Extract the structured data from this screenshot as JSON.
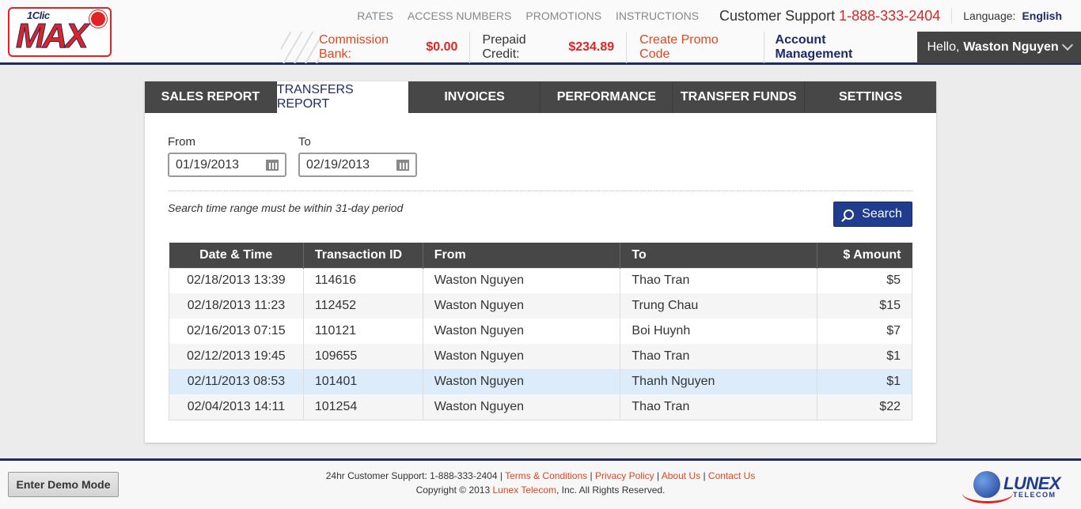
{
  "logo": {
    "top": "1Clic",
    "main": "MAX"
  },
  "topnav": {
    "links": [
      "RATES",
      "ACCESS NUMBERS",
      "PROMOTIONS",
      "INSTRUCTIONS"
    ],
    "support_label": "Customer Support",
    "support_phone": "1-888-333-2404",
    "language_label": "Language:",
    "language_value": "English"
  },
  "subbar": {
    "commission_label": "Commission Bank:",
    "commission_value": "$0.00",
    "prepaid_label": "Prepaid Credit:",
    "prepaid_value": "$234.89",
    "promo": "Create Promo Code",
    "account": "Account Management",
    "hello": "Hello,",
    "user": "Waston Nguyen"
  },
  "tabs": [
    "SALES REPORT",
    "TRANSFERS REPORT",
    "INVOICES",
    "PERFORMANCE",
    "TRANSFER FUNDS",
    "SETTINGS"
  ],
  "active_tab": "TRANSFERS REPORT",
  "filters": {
    "from_label": "From",
    "from_value": "01/19/2013",
    "to_label": "To",
    "to_value": "02/19/2013",
    "hint": "Search time range must be within 31-day period",
    "search": "Search"
  },
  "table": {
    "headers": [
      "Date & Time",
      "Transaction ID",
      "From",
      "To",
      "$ Amount"
    ],
    "rows": [
      [
        "02/18/2013 13:39",
        "114616",
        "Waston Nguyen",
        "Thao Tran",
        "$5"
      ],
      [
        "02/18/2013 11:23",
        "112452",
        "Waston Nguyen",
        "Trung Chau",
        "$15"
      ],
      [
        "02/16/2013 07:15",
        "110121",
        "Waston Nguyen",
        "Boi Huynh",
        "$7"
      ],
      [
        "02/12/2013 19:45",
        "109655",
        "Waston Nguyen",
        "Thao Tran",
        "$1"
      ],
      [
        "02/11/2013 08:53",
        "101401",
        "Waston Nguyen",
        "Thanh Nguyen",
        "$1"
      ],
      [
        "02/04/2013 14:11",
        "101254",
        "Waston Nguyen",
        "Thao Tran",
        "$22"
      ]
    ]
  },
  "footer": {
    "demo": "Enter Demo Mode",
    "support": "24hr Customer Support: 1-888-333-2404",
    "terms": "Terms & Conditions",
    "privacy": "Privacy Policy",
    "about": "About Us",
    "contact": "Contact Us",
    "copyright_pre": "Copyright © 2013",
    "company": "Lunex Telecom",
    "copyright_post": ", Inc. All Rights Reserved."
  },
  "lunex": {
    "name": "LUNEX",
    "sub": "TELECOM"
  },
  "colors": {
    "navy": "#1f2a6b",
    "red": "#e02424",
    "orange": "#e0461e",
    "dark": "#474747",
    "highlight": "#ddecfb"
  }
}
